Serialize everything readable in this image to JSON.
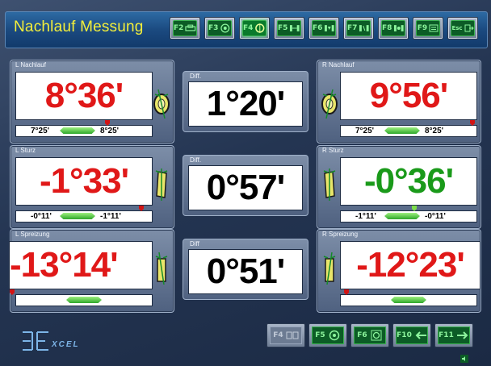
{
  "window": {
    "title": "Nachlauf Messung"
  },
  "toolbar": {
    "keys": [
      {
        "label": "F2",
        "icon": "car-icon",
        "active": false
      },
      {
        "label": "F3",
        "icon": "wheel-target-icon",
        "active": false
      },
      {
        "label": "F4",
        "icon": "caster-icon",
        "active": true
      },
      {
        "label": "F5",
        "icon": "axle-icon",
        "active": false
      },
      {
        "label": "F6",
        "icon": "adjust-icon",
        "active": false
      },
      {
        "label": "F7",
        "icon": "toe-icon",
        "active": false
      },
      {
        "label": "F8",
        "icon": "camber-icon",
        "active": false
      },
      {
        "label": "F9",
        "icon": "list-icon",
        "active": false
      },
      {
        "label": "Esc",
        "icon": "exit-icon",
        "active": false
      }
    ]
  },
  "left_caster": {
    "label": "L Nachlauf",
    "value": "8°36'",
    "tol_min": "7°25'",
    "tol_max": "8°25'"
  },
  "right_caster": {
    "label": "R Nachlauf",
    "value": "9°56'",
    "tol_min": "7°25'",
    "tol_max": "8°25'"
  },
  "left_camber": {
    "label": "L Sturz",
    "value": "-1°33'",
    "tol_min": "-0°11'",
    "tol_max": "-1°11'"
  },
  "right_camber": {
    "label": "R Sturz",
    "value": "-0°36'",
    "tol_min": "-1°11'",
    "tol_max": "-0°11'"
  },
  "left_kpi": {
    "label": "L Spreizung",
    "value": "-13°14'"
  },
  "right_kpi": {
    "label": "R Spreizung",
    "value": "-12°23'"
  },
  "diff_caster": {
    "label": "Diff.",
    "value": "1°20'"
  },
  "diff_camber": {
    "label": "Diff.",
    "value": "0°57'"
  },
  "diff_kpi": {
    "label": "Diff",
    "value": "0°51'"
  },
  "logo": {
    "text": "XCEL"
  },
  "bottom_keys": [
    {
      "label": "F4",
      "icon": "meter-icon",
      "disabled": true
    },
    {
      "label": "F5",
      "icon": "wheel-rotate-icon",
      "disabled": false
    },
    {
      "label": "F6",
      "icon": "wheel-zoom-icon",
      "disabled": false
    },
    {
      "label": "F10",
      "icon": "arrow-left-icon",
      "disabled": false
    },
    {
      "label": "F11",
      "icon": "arrow-right-icon",
      "disabled": false
    }
  ],
  "colors": {
    "out_of_tolerance": "#e01818",
    "in_tolerance": "#1a9a1a",
    "title": "#f4ef3a"
  }
}
